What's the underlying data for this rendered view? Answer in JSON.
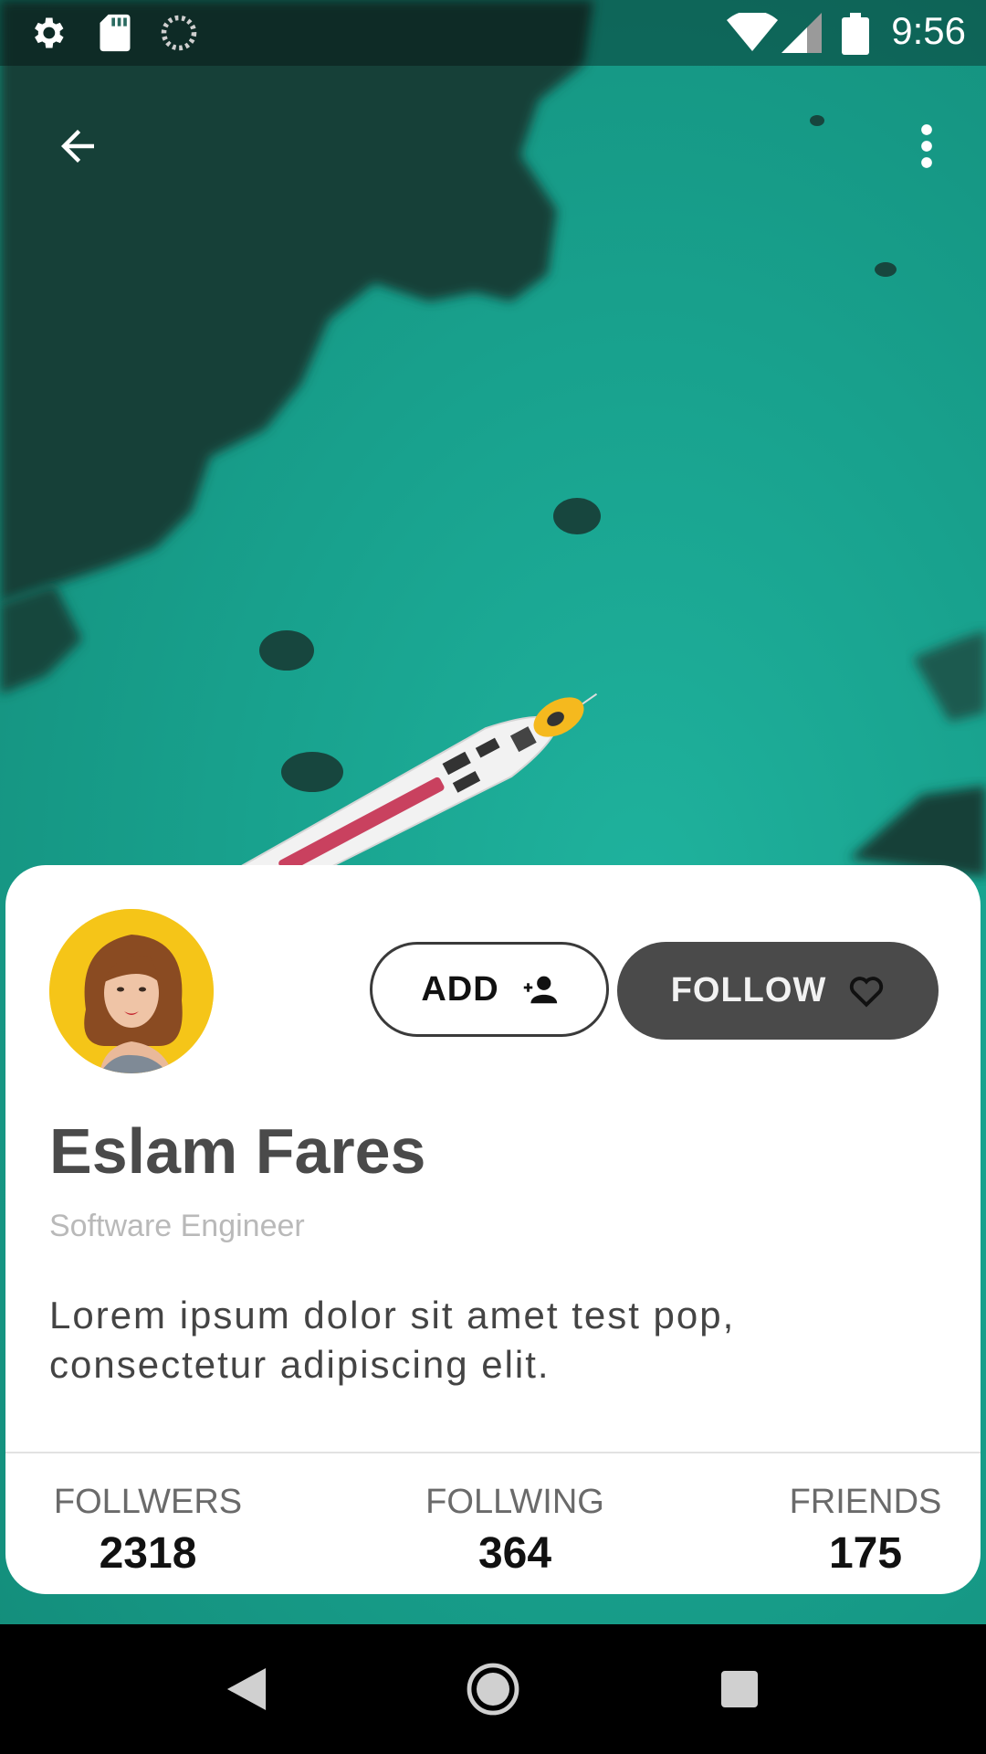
{
  "status_bar": {
    "time": "9:56",
    "icons": [
      "settings-icon",
      "sd-card-icon",
      "sync-icon",
      "wifi-icon",
      "cell-signal-icon",
      "battery-icon"
    ]
  },
  "app_bar": {
    "back_icon": "arrow-back-icon",
    "menu_icon": "more-vert-icon"
  },
  "profile": {
    "name": "Eslam Fares",
    "title": "Software Engineer",
    "bio": "Lorem ipsum dolor sit amet test pop, consectetur adipiscing elit.",
    "avatar_bg": "#F5C518"
  },
  "actions": {
    "add_label": "ADD",
    "add_icon": "person-add-icon",
    "follow_label": "FOLLOW",
    "follow_icon": "heart-outline-icon"
  },
  "stats": [
    {
      "label": "FOLLWERS",
      "value": "2318"
    },
    {
      "label": "FOLLWING",
      "value": "364"
    },
    {
      "label": "FRIENDS",
      "value": "175"
    }
  ],
  "nav_bar": {
    "icons": [
      "nav-back-icon",
      "nav-home-icon",
      "nav-recents-icon"
    ]
  },
  "colors": {
    "sea": "#16A08C",
    "follow_button": "#4A4A4A",
    "name_text": "#4A4A4A",
    "subtitle_text": "#B9B9B9"
  }
}
